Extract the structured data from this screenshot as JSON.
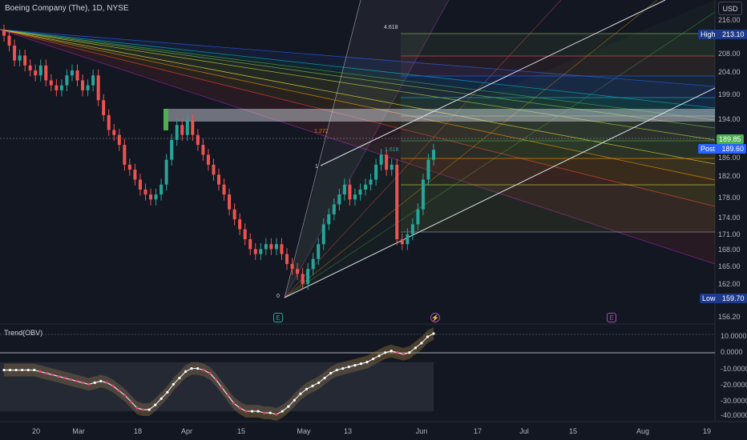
{
  "header": {
    "title": "Boeing Company (The), 1D, NYSE",
    "currency_button": "USD"
  },
  "price_axis": {
    "labels": [
      "216.00",
      "208.00",
      "204.00",
      "199.00",
      "194.00",
      "186.00",
      "182.00",
      "178.00",
      "174.00",
      "171.00",
      "168.00",
      "165.00",
      "162.00",
      "156.20"
    ],
    "high_tag": {
      "label": "High",
      "value": "213.10"
    },
    "last_tag": {
      "value": "189.85"
    },
    "post_tag": {
      "label": "Post",
      "value": "189.60"
    },
    "low_tag": {
      "label": "Low",
      "value": "159.70"
    }
  },
  "obv_axis": {
    "labels": [
      "10.0000",
      "0.0000",
      "-10.0000",
      "-20.0000",
      "-30.0000",
      "-40.0000"
    ]
  },
  "time_axis": {
    "labels": [
      "20",
      "Mar",
      "18",
      "Apr",
      "15",
      "May",
      "13",
      "Jun",
      "17",
      "Jul",
      "15",
      "Aug",
      "19"
    ]
  },
  "indicator": {
    "title": "Trend(OBV)"
  },
  "events": {
    "earnings": "E",
    "dividend": "E",
    "split": "⚡"
  },
  "fib_labels": {
    "top": "4.618",
    "mid": "1.618",
    "l1": "1",
    "l1272": "1.272",
    "zero": "0",
    "one": "1"
  },
  "colors": {
    "bg": "#131722",
    "up": "#26a69a",
    "down": "#ef5350",
    "high_tag": "#1e3a8a",
    "last_tag": "#4caf50",
    "post_tag": "#2962ff"
  },
  "chart_data": {
    "type": "candlestick",
    "symbol": "Boeing Company (The)",
    "interval": "1D",
    "exchange": "NYSE",
    "ylim": [
      156,
      217
    ],
    "last_price": 189.85,
    "post_price": 189.6,
    "high": 213.1,
    "low": 159.7,
    "closes": [
      213,
      211,
      208,
      209,
      207,
      206,
      205,
      207,
      204,
      203,
      202,
      203,
      205,
      206,
      204,
      202,
      203,
      205,
      200,
      197,
      194,
      193,
      191,
      187,
      186,
      184,
      182,
      181,
      180,
      181,
      183,
      188,
      192,
      195,
      193,
      196,
      193,
      191,
      189,
      187,
      185,
      183,
      181,
      178,
      176,
      174,
      172,
      170,
      169,
      170,
      171,
      170,
      171,
      169,
      167,
      166,
      165,
      163,
      166,
      168,
      171,
      175,
      177,
      179,
      181,
      183,
      180,
      181,
      182,
      183,
      184,
      187,
      189,
      186,
      187,
      172,
      171,
      173,
      175,
      178,
      184,
      188,
      190
    ],
    "obv_trend": [
      -12,
      -12,
      -12,
      -12,
      -12,
      -12,
      -13,
      -14,
      -15,
      -16,
      -17,
      -18,
      -19,
      -20,
      -21,
      -20,
      -19,
      -20,
      -22,
      -25,
      -28,
      -32,
      -36,
      -37,
      -37,
      -34,
      -30,
      -26,
      -21,
      -17,
      -13,
      -11,
      -11,
      -12,
      -14,
      -18,
      -23,
      -28,
      -33,
      -36,
      -38,
      -38,
      -38,
      -39,
      -39,
      -40,
      -38,
      -35,
      -31,
      -27,
      -24,
      -22,
      -20,
      -17,
      -14,
      -12,
      -11,
      -10,
      -9,
      -8,
      -7,
      -5,
      -3,
      -1,
      0,
      -1,
      -2,
      -1,
      2,
      5,
      9,
      11
    ]
  }
}
